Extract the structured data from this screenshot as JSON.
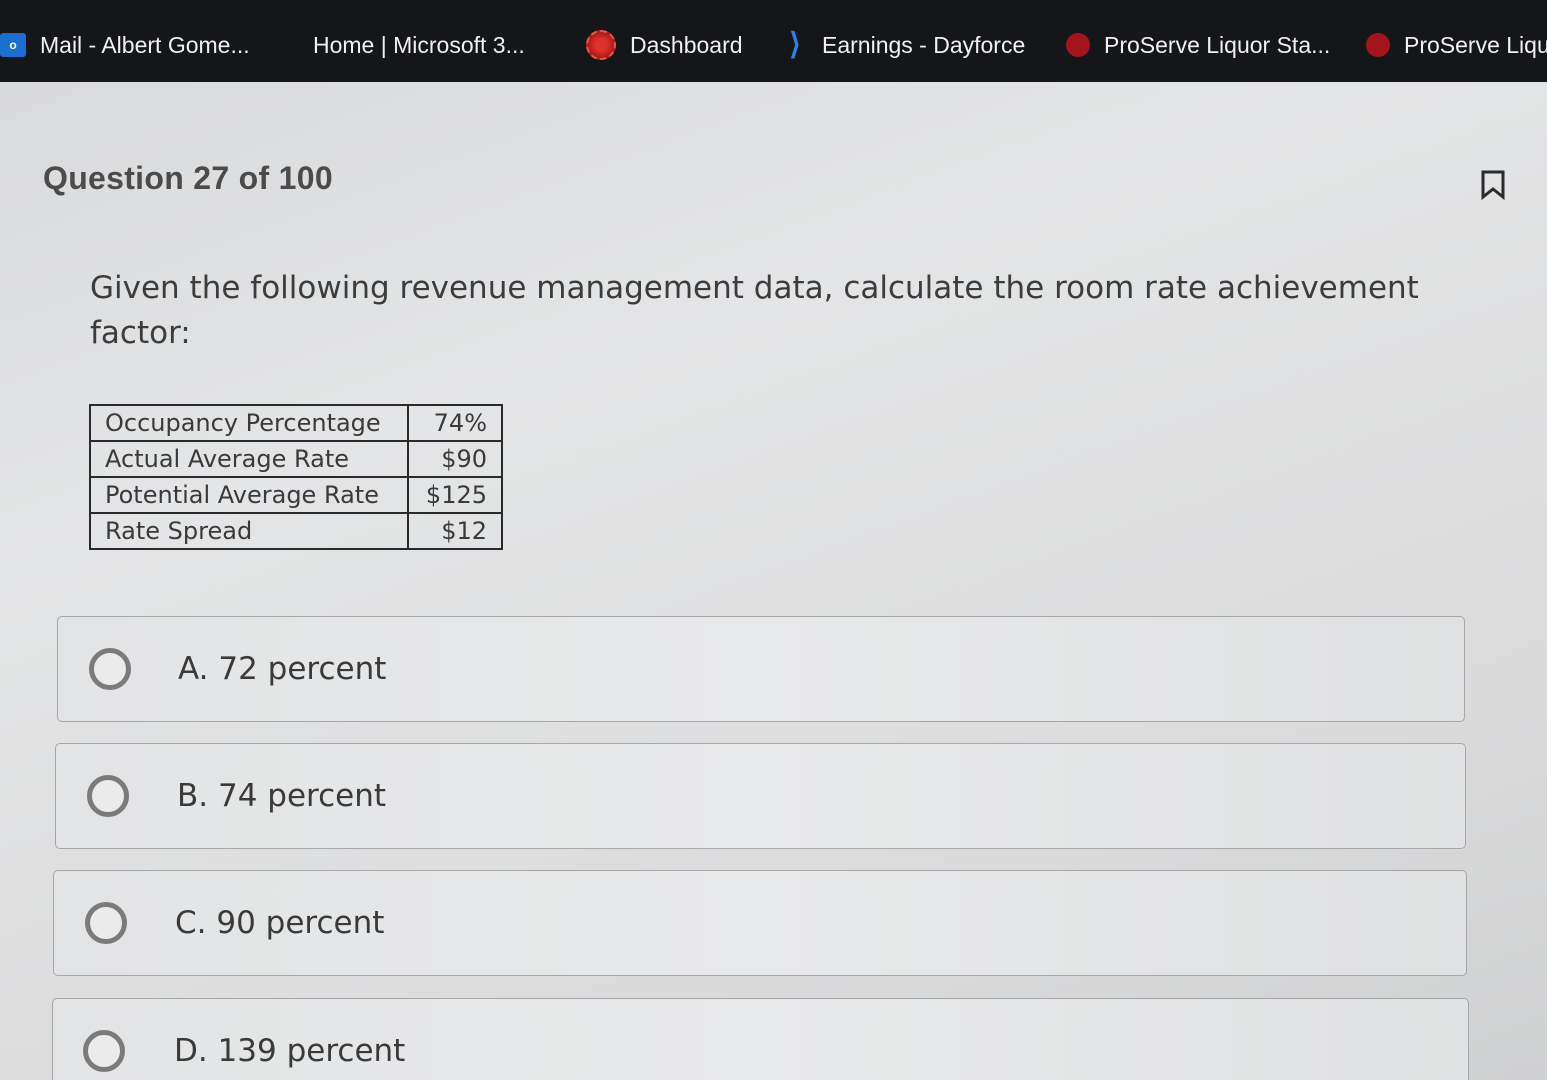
{
  "bookmarks": [
    {
      "label": "Mail - Albert Gome...",
      "icon": "outlook-icon"
    },
    {
      "label": "Home | Microsoft 3...",
      "icon": "microsoft-icon"
    },
    {
      "label": "Dashboard",
      "icon": "dashboard-icon"
    },
    {
      "label": "Earnings - Dayforce",
      "icon": "dayforce-icon"
    },
    {
      "label": "ProServe Liquor Sta...",
      "icon": "proserve-icon"
    },
    {
      "label": "ProServe Liqu",
      "icon": "proserve-icon"
    }
  ],
  "question": {
    "header": "Question 27 of 100",
    "prompt": "Given the following revenue management data, calculate the room rate achievement factor:",
    "table": [
      {
        "label": "Occupancy Percentage",
        "value": "74%"
      },
      {
        "label": "Actual Average Rate",
        "value": "$90"
      },
      {
        "label": "Potential Average Rate",
        "value": "$125"
      },
      {
        "label": "Rate Spread",
        "value": "$12"
      }
    ],
    "options": [
      {
        "label": "A. 72 percent",
        "selected": false
      },
      {
        "label": "B. 74 percent",
        "selected": false
      },
      {
        "label": "C. 90 percent",
        "selected": false
      },
      {
        "label": "D. 139 percent",
        "selected": false
      }
    ]
  }
}
